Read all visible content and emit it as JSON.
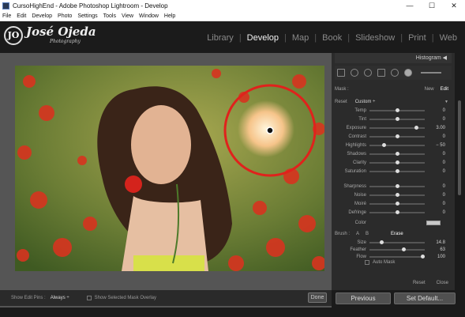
{
  "window": {
    "title": "CursoHighEnd - Adobe Photoshop Lightroom - Develop",
    "min": "—",
    "max": "☐",
    "close": "✕"
  },
  "menu": [
    "File",
    "Edit",
    "Develop",
    "Photo",
    "Settings",
    "Tools",
    "View",
    "Window",
    "Help"
  ],
  "identity": {
    "mark": "JO",
    "name": "José Ojeda",
    "sub": "Photography"
  },
  "modules": [
    "Library",
    "Develop",
    "Map",
    "Book",
    "Slideshow",
    "Print",
    "Web"
  ],
  "active_module": "Develop",
  "panel": {
    "header": "Histogram",
    "mask": {
      "label": "Mask :",
      "new": "New",
      "edit": "Edit"
    },
    "effect": {
      "label": "Reset",
      "preset": "Custom ÷",
      "arrow": "▼"
    },
    "sliders": [
      {
        "label": "Temp",
        "value": "0",
        "pos": 0.5
      },
      {
        "label": "Tint",
        "value": "0",
        "pos": 0.5
      },
      {
        "label": "Exposure",
        "value": "3.00",
        "pos": 0.88
      },
      {
        "label": "Contrast",
        "value": "0",
        "pos": 0.5
      },
      {
        "label": "Highlights",
        "value": "− 50",
        "pos": 0.25
      },
      {
        "label": "Shadows",
        "value": "0",
        "pos": 0.5
      },
      {
        "label": "Clarity",
        "value": "0",
        "pos": 0.5
      },
      {
        "label": "Saturation",
        "value": "0",
        "pos": 0.5
      },
      {
        "label": "Sharpness",
        "value": "0",
        "pos": 0.5
      },
      {
        "label": "Noise",
        "value": "0",
        "pos": 0.5
      },
      {
        "label": "Moiré",
        "value": "0",
        "pos": 0.5
      },
      {
        "label": "Defringe",
        "value": "0",
        "pos": 0.5
      }
    ],
    "color_label": "Color",
    "brush": {
      "label": "Brush :",
      "a": "A",
      "b": "B",
      "erase": "Erase"
    },
    "brush_sliders": [
      {
        "label": "Size",
        "value": "14.8",
        "pos": 0.2
      },
      {
        "label": "Feather",
        "value": "63",
        "pos": 0.63
      },
      {
        "label": "Flow",
        "value": "100",
        "pos": 1.0
      }
    ],
    "auto_mask": "Auto Mask",
    "reset": "Reset",
    "close": "Close"
  },
  "toolbar": {
    "label": "Show Edit Pins :",
    "pins_value": "Always ÷",
    "overlay": "Show Selected Mask Overlay",
    "done": "Done"
  },
  "buttons": {
    "previous": "Previous",
    "set_default": "Set Default..."
  },
  "colors": {
    "accent_ring": "#e0221c",
    "panel_bg": "#2b2b2b",
    "photo_green": "#6c7e3a"
  }
}
